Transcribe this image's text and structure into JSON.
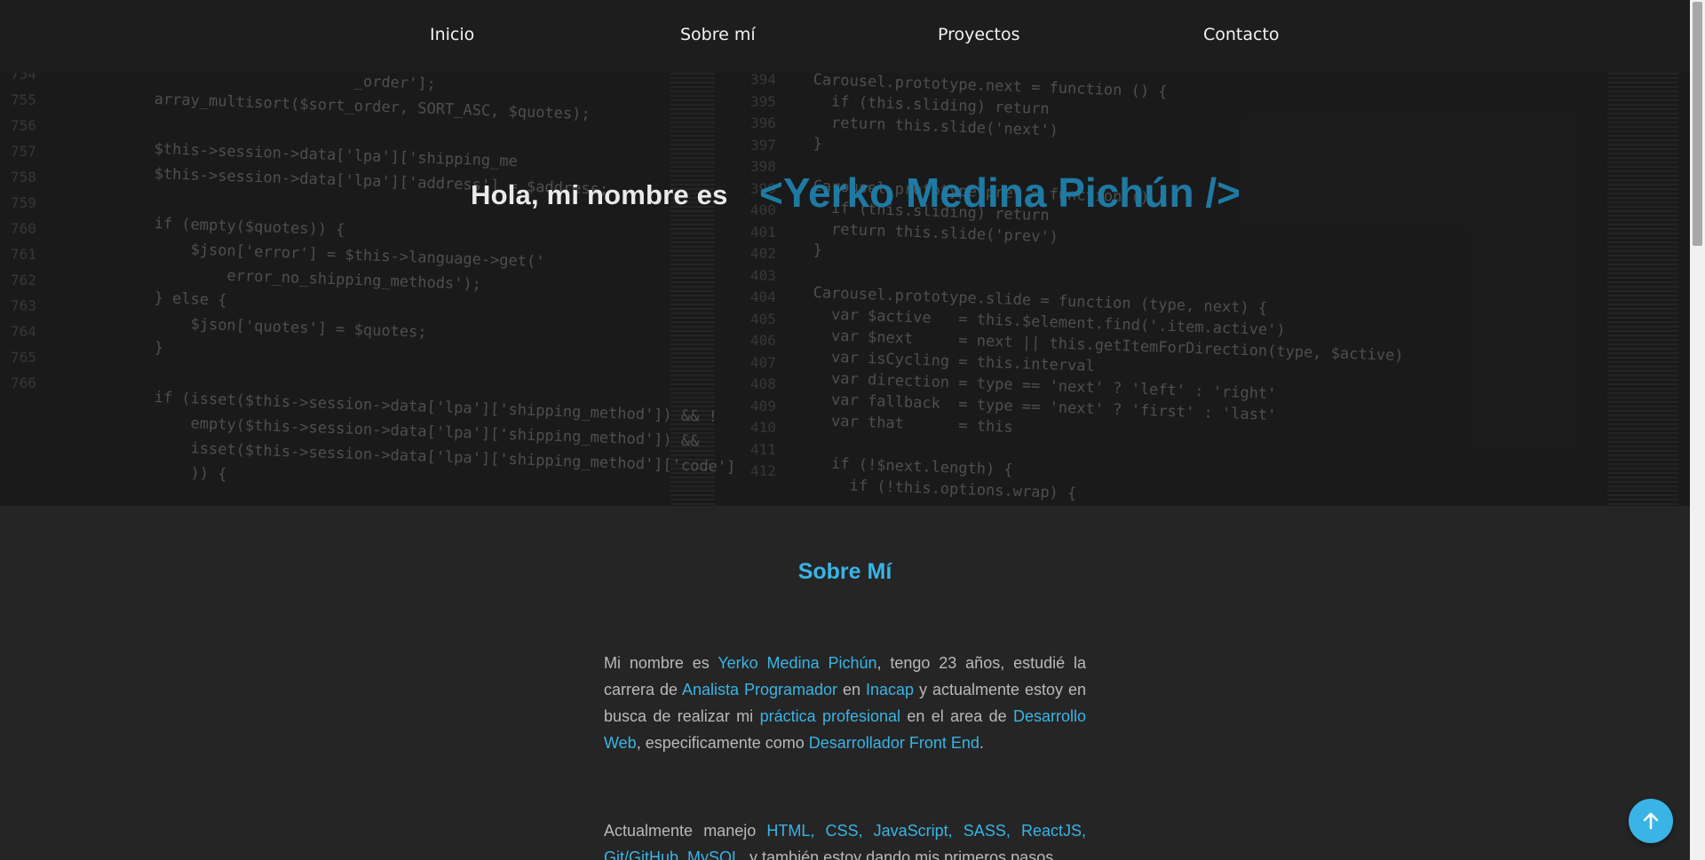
{
  "nav": {
    "items": [
      {
        "label": "Inicio"
      },
      {
        "label": "Sobre mí"
      },
      {
        "label": "Proyectos"
      },
      {
        "label": "Contacto"
      }
    ]
  },
  "hero": {
    "greeting": "Hola, mi nombre es",
    "name": "<Yerko Medina Pichún />",
    "code_left": [
      "                      _order'];",
      "array_multisort($sort_order, SORT_ASC, $quotes);",
      "",
      "$this->session->data['lpa']['shipping_me",
      "$this->session->data['lpa']['address'] = $address;",
      "",
      "if (empty($quotes)) {",
      "    $json['error'] = $this->language->get('",
      "        error_no_shipping_methods');",
      "} else {",
      "    $json['quotes'] = $quotes;",
      "}",
      "",
      "if (isset($this->session->data['lpa']['shipping_method']) && !",
      "    empty($this->session->data['lpa']['shipping_method']) &&",
      "    isset($this->session->data['lpa']['shipping_method']['code']",
      "    )) {"
    ],
    "code_right": [
      "Carousel.prototype.next = function () {",
      "  if (this.sliding) return",
      "  return this.slide('next')",
      "}",
      "",
      "Carousel.prototype.prev = function () {",
      "  if (this.sliding) return",
      "  return this.slide('prev')",
      "}",
      "",
      "Carousel.prototype.slide = function (type, next) {",
      "  var $active   = this.$element.find('.item.active')",
      "  var $next     = next || this.getItemForDirection(type, $active)",
      "  var isCycling = this.interval",
      "  var direction = type == 'next' ? 'left' : 'right'",
      "  var fallback  = type == 'next' ? 'first' : 'last'",
      "  var that      = this",
      "",
      "  if (!$next.length) {",
      "    if (!this.options.wrap) {"
    ],
    "line_numbers_left": [
      "754",
      "755",
      "756",
      "757",
      "758",
      "759",
      "760",
      "761",
      "762",
      "763",
      "764",
      "765",
      "766"
    ],
    "line_numbers_right": [
      "394",
      "395",
      "396",
      "397",
      "398",
      "399",
      "400",
      "401",
      "402",
      "403",
      "404",
      "405",
      "406",
      "407",
      "408",
      "409",
      "410",
      "411",
      "412"
    ]
  },
  "about": {
    "title": "Sobre Mí",
    "para1": [
      {
        "t": "Mi nombre es ",
        "h": false
      },
      {
        "t": "Yerko Medina Pichún",
        "h": true
      },
      {
        "t": ", tengo 23 años, estudié la carrera de ",
        "h": false
      },
      {
        "t": "Analista Programador",
        "h": true
      },
      {
        "t": " en ",
        "h": false
      },
      {
        "t": "Inacap",
        "h": true
      },
      {
        "t": " y actualmente estoy en busca de realizar mi ",
        "h": false
      },
      {
        "t": "práctica profesional",
        "h": true
      },
      {
        "t": " en el area de ",
        "h": false
      },
      {
        "t": "Desarrollo Web",
        "h": true
      },
      {
        "t": ", especificamente como ",
        "h": false
      },
      {
        "t": "Desarrollador Front End",
        "h": true
      },
      {
        "t": ".",
        "h": false
      }
    ],
    "para2": [
      {
        "t": "Actualmente manejo ",
        "h": false
      },
      {
        "t": "HTML, CSS, JavaScript, SASS, ReactJS, Git/GitHub, MySQL",
        "h": true
      },
      {
        "t": ", y también estoy dando mis primeros pasos",
        "h": false
      }
    ]
  },
  "colors": {
    "accent": "#3ab4e6",
    "name": "#1f7aa3",
    "background": "#252525",
    "navbar": "#1d1d1d"
  },
  "icons": {
    "back_to_top": "arrow-up-icon"
  }
}
